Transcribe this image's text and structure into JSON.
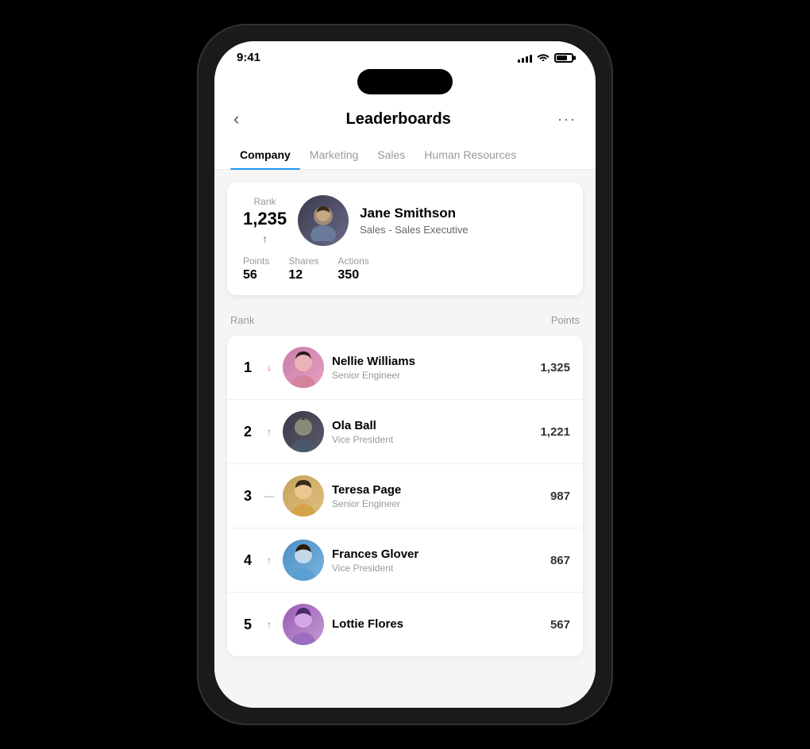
{
  "statusBar": {
    "time": "9:41",
    "signalBars": [
      4,
      6,
      8,
      10,
      12
    ],
    "battery": 70
  },
  "header": {
    "title": "Leaderboards",
    "backLabel": "‹",
    "moreLabel": "···"
  },
  "tabs": [
    {
      "id": "company",
      "label": "Company",
      "active": true
    },
    {
      "id": "marketing",
      "label": "Marketing",
      "active": false
    },
    {
      "id": "sales",
      "label": "Sales",
      "active": false
    },
    {
      "id": "hr",
      "label": "Human Resources",
      "active": false
    }
  ],
  "myRank": {
    "rankLabel": "Rank",
    "rankNumber": "1,235",
    "trendIcon": "↑",
    "name": "Jane Smithson",
    "role": "Sales - Sales Executive",
    "stats": [
      {
        "label": "Points",
        "value": "56"
      },
      {
        "label": "Shares",
        "value": "12"
      },
      {
        "label": "Actions",
        "value": "350"
      }
    ]
  },
  "listHeader": {
    "rankLabel": "Rank",
    "pointsLabel": "Points"
  },
  "leaderboard": [
    {
      "rank": "1",
      "trend": "↓",
      "trendType": "down",
      "name": "Nellie Williams",
      "role": "Senior Engineer",
      "points": "1,325",
      "avatarClass": "avatar-1",
      "avatarEmoji": "👩"
    },
    {
      "rank": "2",
      "trend": "↑",
      "trendType": "up",
      "name": "Ola Ball",
      "role": "Vice President",
      "points": "1,221",
      "avatarClass": "avatar-2",
      "avatarEmoji": "🧑"
    },
    {
      "rank": "3",
      "trend": "—",
      "trendType": "neutral",
      "name": "Teresa Page",
      "role": "Senior Engineer",
      "points": "987",
      "avatarClass": "avatar-3",
      "avatarEmoji": "👩"
    },
    {
      "rank": "4",
      "trend": "↑",
      "trendType": "up",
      "name": "Frances Glover",
      "role": "Vice President",
      "points": "867",
      "avatarClass": "avatar-4",
      "avatarEmoji": "👩"
    },
    {
      "rank": "5",
      "trend": "↑",
      "trendType": "up",
      "name": "Lottie Flores",
      "role": "",
      "points": "567",
      "avatarClass": "avatar-5",
      "avatarEmoji": "👩"
    }
  ]
}
